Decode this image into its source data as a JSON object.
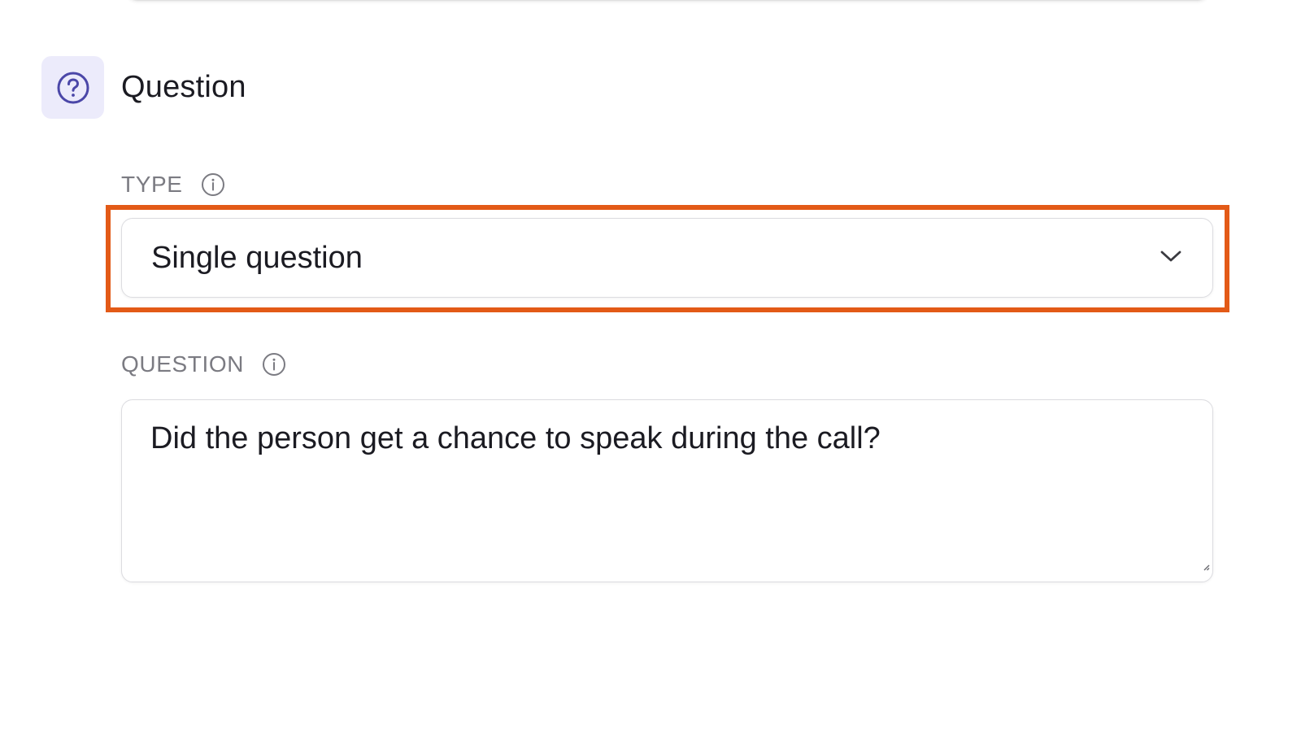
{
  "section": {
    "title": "Question",
    "icon": "question-circle-icon",
    "icon_tile_color": "#ecebfb",
    "icon_color": "#4b47a8"
  },
  "type_field": {
    "label": "TYPE",
    "info_icon": "info-icon",
    "selected_value": "Single question",
    "dropdown_icon": "chevron-down-icon",
    "highlighted": true,
    "highlight_color": "#e35a17"
  },
  "question_field": {
    "label": "QUESTION",
    "info_icon": "info-icon",
    "value": "Did the person get a chance to speak during the call?"
  }
}
